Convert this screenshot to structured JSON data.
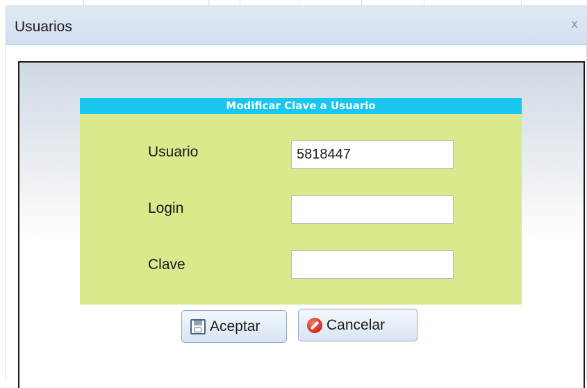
{
  "window": {
    "title": "Usuarios",
    "close_label": "x"
  },
  "form": {
    "header": "Modificar Clave a Usuario",
    "fields": [
      {
        "label": "Usuario",
        "value": "5818447",
        "placeholder": ""
      },
      {
        "label": "Login",
        "value": "",
        "placeholder": ""
      },
      {
        "label": "Clave",
        "value": "",
        "placeholder": ""
      }
    ]
  },
  "buttons": {
    "accept_label": "Aceptar",
    "cancel_label": "Cancelar"
  },
  "icons": {
    "accept": "floppy-disk-icon",
    "cancel": "cancel-icon"
  },
  "colors": {
    "header_bg": "#18c6f0",
    "form_bg": "#d9e98c",
    "titlebar_bg": "#d3e0f0"
  }
}
